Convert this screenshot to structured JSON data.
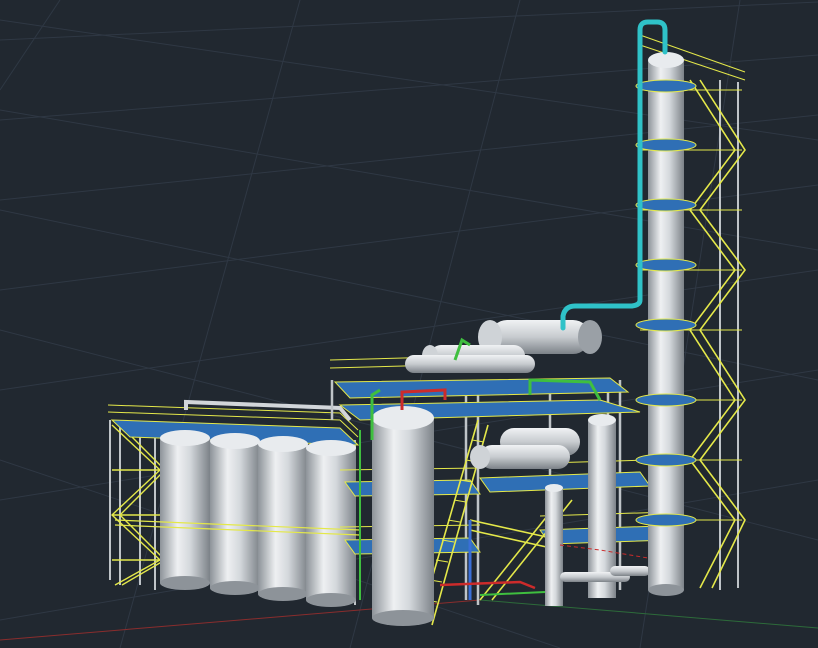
{
  "viewport": {
    "background": "#212830",
    "grid_color": "#2f3844",
    "x_axis_color": "#8a2d2d",
    "y_axis_color": "#2d6b3a"
  },
  "model": {
    "equipment_color": "#d2d6da",
    "steel_color": "#e4e84a",
    "floor_color": "#2f6fb5",
    "pipe_colors": {
      "overhead_line": "#2fc2c8",
      "green_line": "#3fbf3f",
      "red_line": "#cc2b2b",
      "blue_line": "#3a6fd8"
    }
  }
}
